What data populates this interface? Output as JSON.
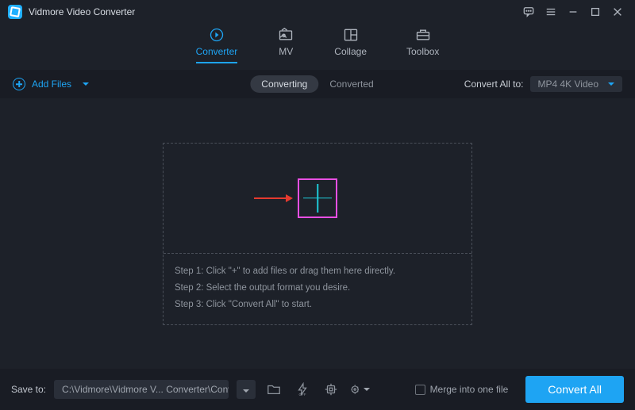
{
  "app_title": "Vidmore Video Converter",
  "tabs": [
    {
      "label": "Converter"
    },
    {
      "label": "MV"
    },
    {
      "label": "Collage"
    },
    {
      "label": "Toolbox"
    }
  ],
  "toolbar": {
    "add_files_label": "Add Files",
    "seg_converting": "Converting",
    "seg_converted": "Converted",
    "convert_all_to_label": "Convert All to:",
    "convert_all_to_value": "MP4 4K Video"
  },
  "drop": {
    "step1": "Step 1: Click \"+\" to add files or drag them here directly.",
    "step2": "Step 2: Select the output format you desire.",
    "step3": "Step 3: Click \"Convert All\" to start."
  },
  "footer": {
    "save_to_label": "Save to:",
    "save_path": "C:\\Vidmore\\Vidmore V... Converter\\Converted",
    "merge_label": "Merge into one file",
    "convert_all_btn": "Convert All"
  }
}
